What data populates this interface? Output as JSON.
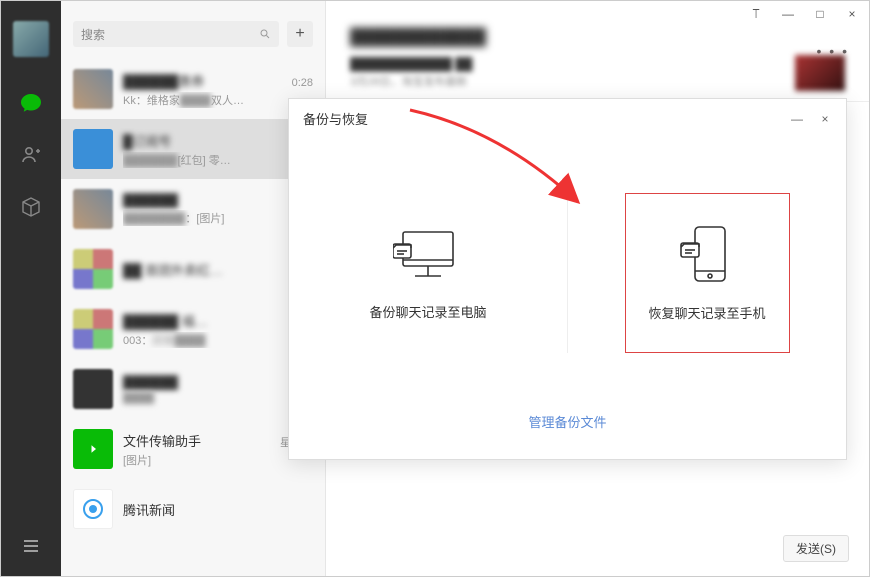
{
  "nav": {
    "chat_label": "chat",
    "contacts_label": "contacts",
    "favorites_label": "favorites",
    "menu_label": "menu"
  },
  "search": {
    "placeholder": "搜索",
    "plus": "+"
  },
  "chats": [
    {
      "title": "██████惠券",
      "time": "0:28",
      "sub_prefix": "Kk：维格家",
      "sub_blur": "████",
      "sub_suffix": "双人…"
    },
    {
      "title": "█订阅号",
      "time": "",
      "sub_prefix": "",
      "sub_blur": "███████",
      "sub_suffix": "[红包] 零…"
    },
    {
      "title": "██████",
      "time": "",
      "sub_prefix": "",
      "sub_blur": "████████",
      "sub_suffix": "：[图片]"
    },
    {
      "title": "██ 首团外卖红…",
      "time": "",
      "sub_prefix": "",
      "sub_blur": "",
      "sub_suffix": ""
    },
    {
      "title": "██████ 福…",
      "time": "",
      "sub_prefix": "003：",
      "sub_blur": "回答████",
      "sub_suffix": ""
    },
    {
      "title": "██████",
      "time": "",
      "sub_prefix": "",
      "sub_blur": "████",
      "sub_suffix": ""
    },
    {
      "title": "文件传输助手",
      "time": "星期…",
      "sub_prefix": "[图片]",
      "sub_blur": "",
      "sub_suffix": ""
    },
    {
      "title": "腾讯新闻",
      "time": "",
      "sub_prefix": "",
      "sub_blur": "",
      "sub_suffix": ""
    }
  ],
  "main": {
    "title_blur": "████████████",
    "sub_blur_a": "████████████ ██",
    "sub_blur_b": "3月28日，淘宝发布最新",
    "send_button": "发送(S)"
  },
  "modal": {
    "title": "备份与恢复",
    "backup_label": "备份聊天记录至电脑",
    "restore_label": "恢复聊天记录至手机",
    "manage_link": "管理备份文件"
  },
  "titlebar": {
    "pin": "⟙",
    "min": "—",
    "max": "□",
    "close": "×"
  }
}
